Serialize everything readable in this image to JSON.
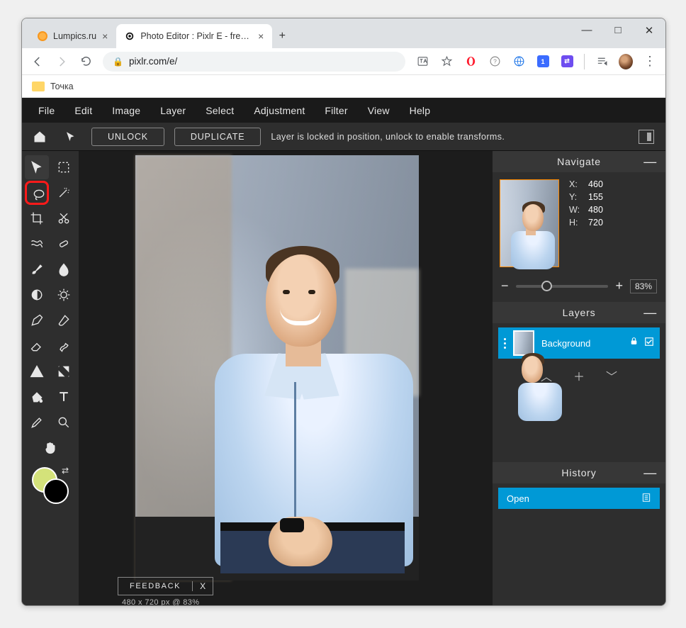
{
  "browser": {
    "tabs": [
      {
        "title": "Lumpics.ru"
      },
      {
        "title": "Photo Editor : Pixlr E - free image"
      }
    ],
    "url": "pixlr.com/e/",
    "bookmark": "Точка"
  },
  "menus": [
    "File",
    "Edit",
    "Image",
    "Layer",
    "Select",
    "Adjustment",
    "Filter",
    "View",
    "Help"
  ],
  "optbar": {
    "unlock": "UNLOCK",
    "duplicate": "DUPLICATE",
    "message": "Layer is locked in position, unlock to enable transforms."
  },
  "tools": [
    "move",
    "marquee",
    "lasso",
    "wand",
    "crop",
    "cut",
    "liquify",
    "heal",
    "brush",
    "blur",
    "dodge",
    "sharpen",
    "pen",
    "paint",
    "eraser",
    "smudge",
    "shape",
    "gradient",
    "fill",
    "text",
    "picker",
    "zoom",
    "hand"
  ],
  "colors": {
    "fg": "#d4e27a",
    "bg": "#000000"
  },
  "panels": {
    "navigate": {
      "title": "Navigate",
      "x_label": "X:",
      "x": "460",
      "y_label": "Y:",
      "y": "155",
      "w_label": "W:",
      "w": "480",
      "h_label": "H:",
      "h": "720",
      "zoom": "83%"
    },
    "layers": {
      "title": "Layers",
      "items": [
        {
          "name": "Background"
        }
      ]
    },
    "history": {
      "title": "History",
      "items": [
        "Open"
      ]
    }
  },
  "feedback": {
    "label": "FEEDBACK",
    "close": "X"
  },
  "status": "480 x 720 px @ 83%"
}
